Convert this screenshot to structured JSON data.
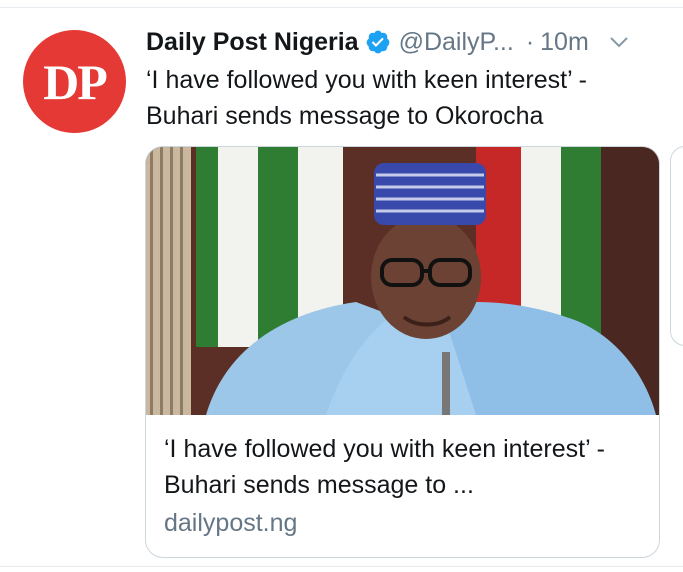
{
  "tweet": {
    "display_name": "Daily Post Nigeria",
    "handle": "@DailyP...",
    "separator": "·",
    "timestamp": "10m",
    "text": "‘I have followed you with keen interest’ - Buhari sends message to Okorocha",
    "avatar_text": "DP",
    "verified_icon": "verified-badge-icon",
    "menu_icon": "chevron-down-icon"
  },
  "card": {
    "title": "‘I have followed you with keen interest’ - Buhari sends message to ...",
    "domain": "dailypost.ng"
  },
  "colors": {
    "avatar_bg": "#e53935",
    "verified": "#1da1f2",
    "secondary_text": "#657786",
    "border": "#ccd6dd"
  }
}
